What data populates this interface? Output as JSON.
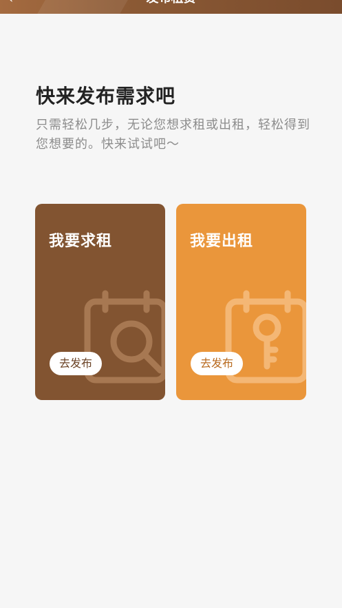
{
  "header": {
    "title": "发布租赁",
    "back_icon": "chevron-left-icon"
  },
  "intro": {
    "headline": "快来发布需求吧",
    "subtext": "只需轻松几步，无论您想求租或出租，轻松得到您想要的。快来试试吧～"
  },
  "cards": [
    {
      "title": "我要求租",
      "button_label": "去发布",
      "icon": "calendar-search-icon",
      "color": "#825431"
    },
    {
      "title": "我要出租",
      "button_label": "去发布",
      "icon": "calendar-key-icon",
      "color": "#ea963b"
    }
  ]
}
